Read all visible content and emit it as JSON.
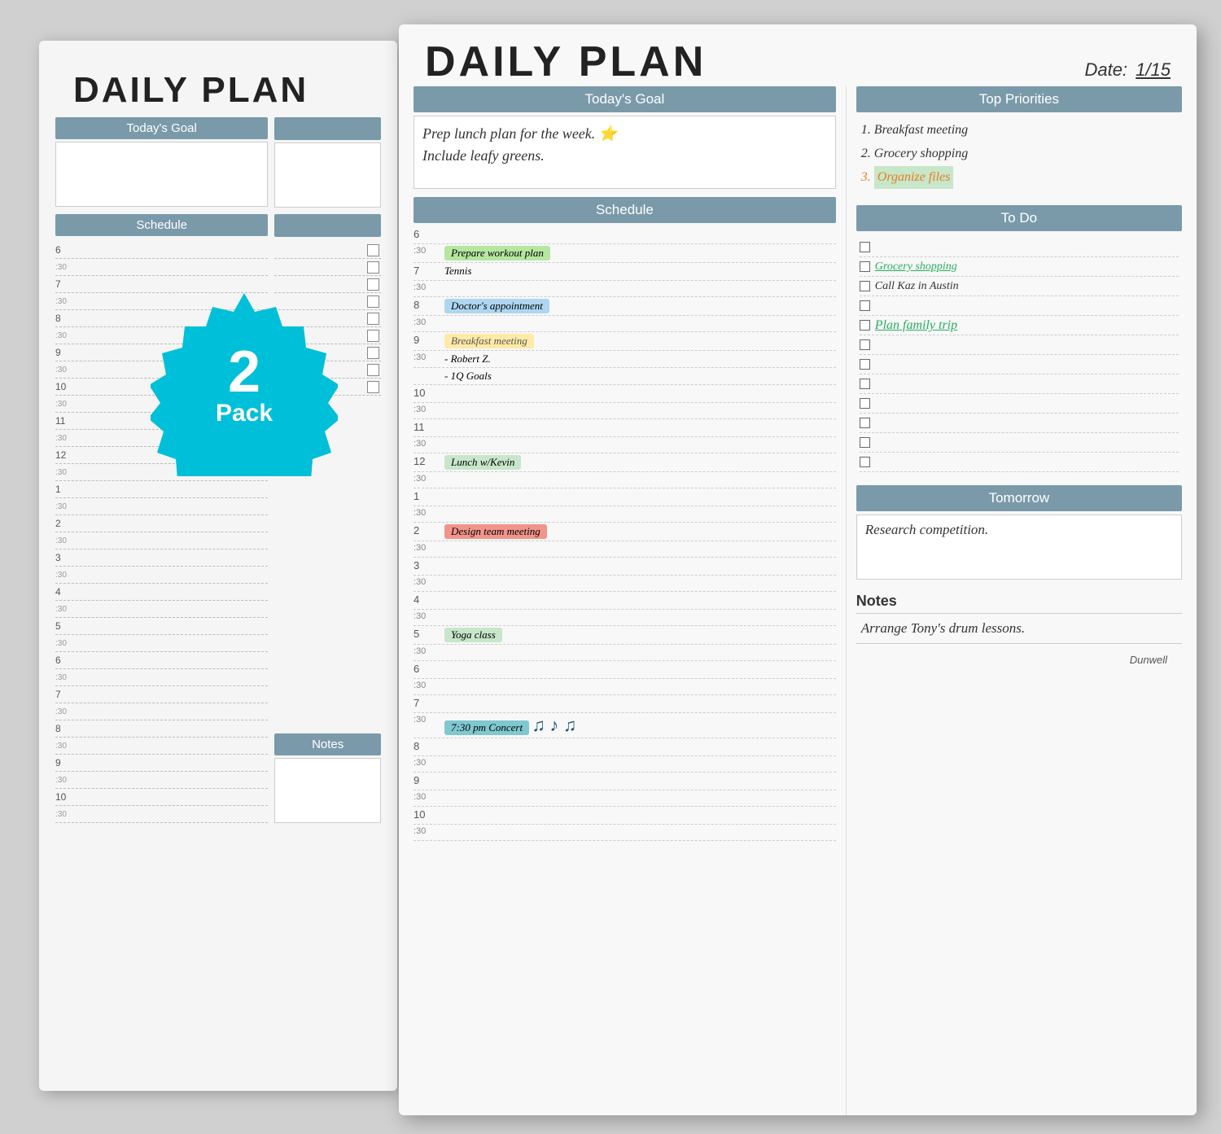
{
  "back_pad": {
    "title": "DAILY PLAN",
    "sections": {
      "goal": {
        "label": "Today's Goal"
      },
      "schedule": {
        "label": "Schedule"
      },
      "notes": {
        "label": "Notes"
      }
    },
    "schedule_hours": [
      "6",
      ":30",
      "7",
      ":30",
      "8",
      ":30",
      "9",
      ":30",
      "10",
      ":30",
      "11",
      ":30",
      "12",
      ":30",
      "1",
      ":30",
      "2",
      ":30",
      "3",
      ":30",
      "4",
      ":30",
      "5",
      ":30",
      "6",
      ":30",
      "7",
      ":30",
      "8",
      ":30",
      "9",
      ":30",
      "10",
      ":30"
    ]
  },
  "badge": {
    "number": "2",
    "label": "Pack"
  },
  "front_pad": {
    "title": "DAILY PLAN",
    "date_label": "Date:",
    "date_value": "1/15",
    "sections": {
      "goal": {
        "label": "Today's Goal",
        "content_line1": "Prep lunch plan for the week. ⭐",
        "content_line2": "Include leafy greens."
      },
      "priorities": {
        "label": "Top Priorities",
        "items": [
          {
            "number": "1.",
            "text": "Breakfast  meeting",
            "highlight": false
          },
          {
            "number": "2.",
            "text": "Grocery shopping",
            "highlight": false
          },
          {
            "number": "3.",
            "text": "Organize files",
            "highlight": true
          }
        ]
      },
      "schedule": {
        "label": "Schedule",
        "rows": [
          {
            "time": "6",
            "half": false,
            "event": null
          },
          {
            "time": ":30",
            "half": true,
            "event": {
              "text": "Prepare workout plan",
              "color": "green"
            }
          },
          {
            "time": "7",
            "half": false,
            "event": {
              "text": "Tennis",
              "color": null
            }
          },
          {
            "time": ":30",
            "half": true,
            "event": null
          },
          {
            "time": "8",
            "half": false,
            "event": {
              "text": "Doctor's appointment",
              "color": "blue"
            }
          },
          {
            "time": ":30",
            "half": true,
            "event": null
          },
          {
            "time": "9",
            "half": false,
            "event": {
              "text": "Breakfast  meeting",
              "color": "yellow"
            }
          },
          {
            "time": ":30",
            "half": true,
            "event": {
              "text": "- Robert Z.",
              "color": null
            }
          },
          {
            "time": null,
            "half": true,
            "event": {
              "text": "- 1Q Goals",
              "color": null
            }
          },
          {
            "time": "10",
            "half": false,
            "event": null
          },
          {
            "time": ":30",
            "half": true,
            "event": null
          },
          {
            "time": "11",
            "half": false,
            "event": null
          },
          {
            "time": ":30",
            "half": true,
            "event": null
          },
          {
            "time": "12",
            "half": false,
            "event": {
              "text": "Lunch w/Kevin",
              "color": "lime"
            }
          },
          {
            "time": ":30",
            "half": true,
            "event": null
          },
          {
            "time": "1",
            "half": false,
            "event": null
          },
          {
            "time": ":30",
            "half": true,
            "event": null
          },
          {
            "time": "2",
            "half": false,
            "event": {
              "text": "Design team meeting",
              "color": "orange"
            }
          },
          {
            "time": ":30",
            "half": true,
            "event": null
          },
          {
            "time": "3",
            "half": false,
            "event": null
          },
          {
            "time": ":30",
            "half": true,
            "event": null
          },
          {
            "time": "4",
            "half": false,
            "event": null
          },
          {
            "time": ":30",
            "half": true,
            "event": null
          },
          {
            "time": "5",
            "half": false,
            "event": {
              "text": "Yoga class",
              "color": "lime"
            }
          },
          {
            "time": ":30",
            "half": true,
            "event": null
          },
          {
            "time": "6",
            "half": false,
            "event": null
          },
          {
            "time": ":30",
            "half": true,
            "event": null
          },
          {
            "time": "7",
            "half": false,
            "event": null
          },
          {
            "time": ":30",
            "half": true,
            "event": {
              "text": "7:30 pm Concert",
              "color": "teal",
              "music": true
            }
          },
          {
            "time": "8",
            "half": false,
            "event": null
          },
          {
            "time": ":30",
            "half": true,
            "event": null
          },
          {
            "time": "9",
            "half": false,
            "event": null
          },
          {
            "time": ":30",
            "half": true,
            "event": null
          },
          {
            "time": "10",
            "half": false,
            "event": null
          },
          {
            "time": ":30",
            "half": true,
            "event": null
          }
        ]
      },
      "todo": {
        "label": "To Do",
        "items": [
          {
            "text": "",
            "checked": false,
            "color": null
          },
          {
            "text": "Grocery shopping",
            "checked": false,
            "color": "green"
          },
          {
            "text": "Call Kaz in Austin",
            "checked": false,
            "color": null
          },
          {
            "text": "",
            "checked": false,
            "color": null
          },
          {
            "text": "Plan family trip",
            "checked": false,
            "color": "yellow"
          },
          {
            "text": "",
            "checked": false,
            "color": null
          },
          {
            "text": "",
            "checked": false,
            "color": null
          },
          {
            "text": "",
            "checked": false,
            "color": null
          },
          {
            "text": "",
            "checked": false,
            "color": null
          },
          {
            "text": "",
            "checked": false,
            "color": null
          },
          {
            "text": "",
            "checked": false,
            "color": null
          },
          {
            "text": "",
            "checked": false,
            "color": null
          }
        ]
      },
      "tomorrow": {
        "label": "Tomorrow",
        "content": "Research competition."
      },
      "notes": {
        "label": "Notes",
        "content": "Arrange Tony's drum lessons."
      }
    },
    "dunwell": "Dunwell"
  }
}
